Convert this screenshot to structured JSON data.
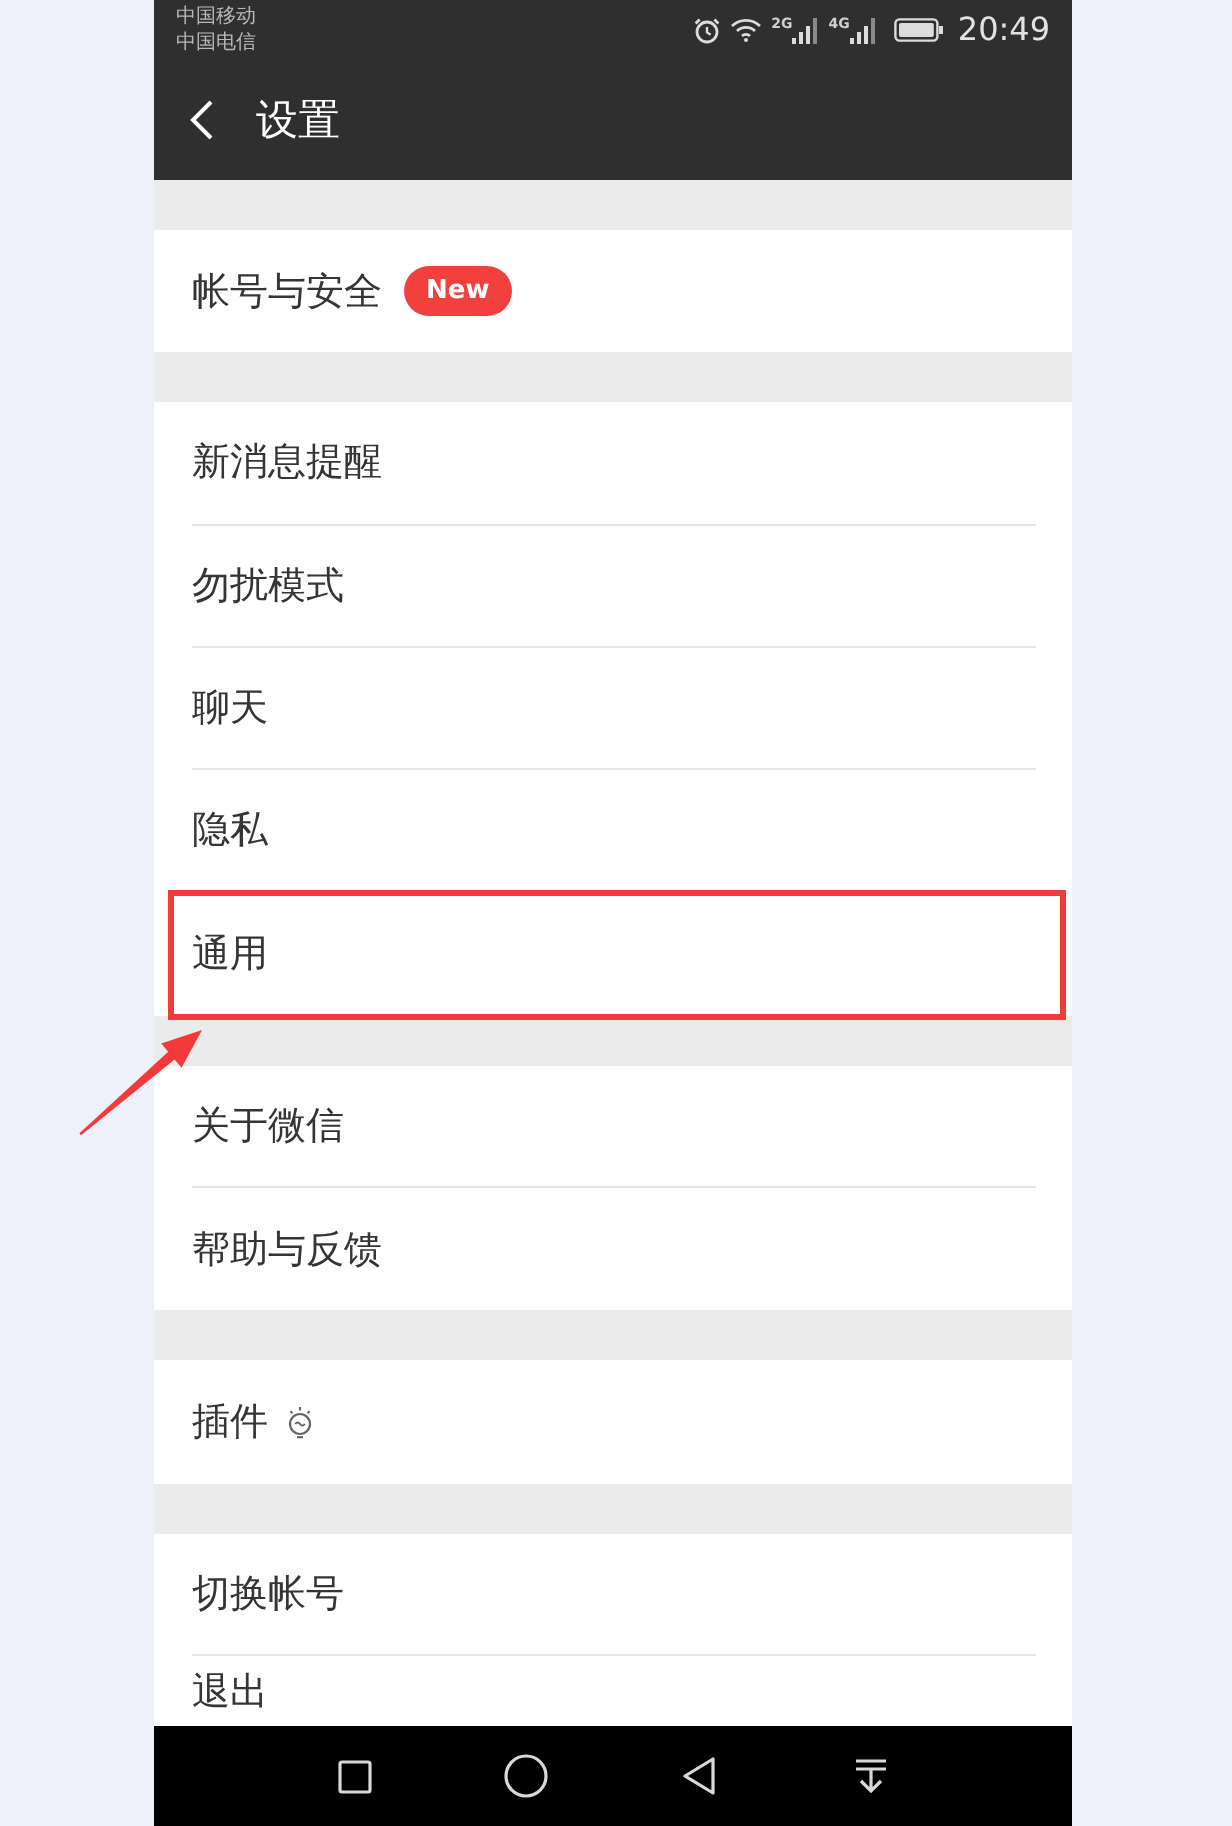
{
  "status_bar": {
    "carriers": [
      "中国移动",
      "中国电信"
    ],
    "network_types": [
      "2G",
      "4G"
    ],
    "time": "20:49"
  },
  "header": {
    "title": "设置"
  },
  "sections": [
    {
      "items": [
        {
          "label": "帐号与安全",
          "badge": "New",
          "highlighted": false
        }
      ]
    },
    {
      "items": [
        {
          "label": "新消息提醒",
          "highlighted": false
        },
        {
          "label": "勿扰模式",
          "highlighted": false
        },
        {
          "label": "聊天",
          "highlighted": false
        },
        {
          "label": "隐私",
          "highlighted": false
        },
        {
          "label": "通用",
          "highlighted": true
        }
      ]
    },
    {
      "items": [
        {
          "label": "关于微信",
          "highlighted": false
        },
        {
          "label": "帮助与反馈",
          "highlighted": false
        }
      ]
    },
    {
      "items": [
        {
          "label": "插件",
          "icon": true,
          "highlighted": false
        }
      ]
    },
    {
      "items": [
        {
          "label": "切换帐号",
          "highlighted": false
        },
        {
          "label": "退出",
          "highlighted": false
        }
      ]
    }
  ]
}
